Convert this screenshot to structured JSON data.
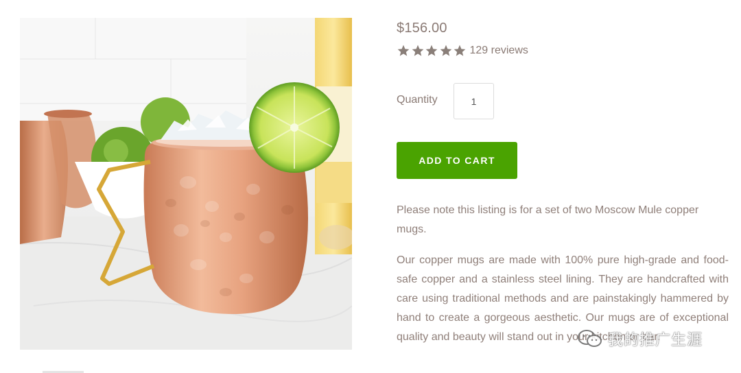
{
  "product": {
    "image_alt": "Hammered copper Moscow Mule mug with crushed ice and lime",
    "price": "$156.00",
    "rating": {
      "stars": 5,
      "max_stars": 5,
      "reviews_text": "129 reviews"
    }
  },
  "quantity": {
    "label": "Quantity",
    "value": "1"
  },
  "cart": {
    "button_label": "ADD TO CART"
  },
  "description": {
    "paragraph_1": "Please note this listing is for a set of two Moscow Mule copper mugs.",
    "paragraph_2": "Our copper mugs are made with 100% pure high-grade and food-safe copper and a stainless steel lining. They are handcrafted with care using traditional methods and are painstakingly hammered by hand to create a gorgeous aesthetic. Our mugs are of exceptional quality and beauty will stand out in your kitchen or bar."
  },
  "watermark": {
    "icon": "wechat-icon",
    "text": "我的推广生涯"
  },
  "colors": {
    "accent_green": "#4aa301",
    "text_brown": "#8f7f79",
    "star_gray": "#8a7f79",
    "copper": "#e2a17f"
  }
}
